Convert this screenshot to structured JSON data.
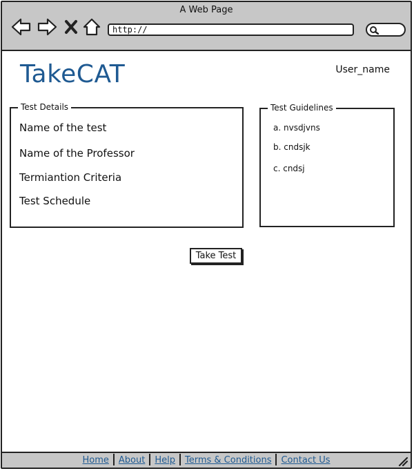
{
  "window": {
    "title": "A Web Page"
  },
  "browser": {
    "url": "http://",
    "icons": [
      "back-arrow-icon",
      "forward-arrow-icon",
      "close-x-icon",
      "home-icon",
      "search-icon"
    ]
  },
  "header": {
    "logo": "TakeCAT",
    "username": "User_name"
  },
  "test_details": {
    "legend": "Test Details",
    "items": [
      "Name of the test",
      "Name of the Professor",
      "Termiantion Criteria",
      "Test Schedule"
    ]
  },
  "test_guidelines": {
    "legend": "Test Guidelines",
    "items": [
      "a. nvsdjvns",
      "b. cndsjk",
      "c. cndsj"
    ]
  },
  "actions": {
    "take_test": "Take Test"
  },
  "footer": {
    "links": [
      "Home",
      "About",
      "Help",
      "Terms & Conditions",
      "Contact Us"
    ]
  },
  "colors": {
    "accent": "#1f5a92",
    "chrome": "#c7c7c7",
    "border": "#222222"
  }
}
